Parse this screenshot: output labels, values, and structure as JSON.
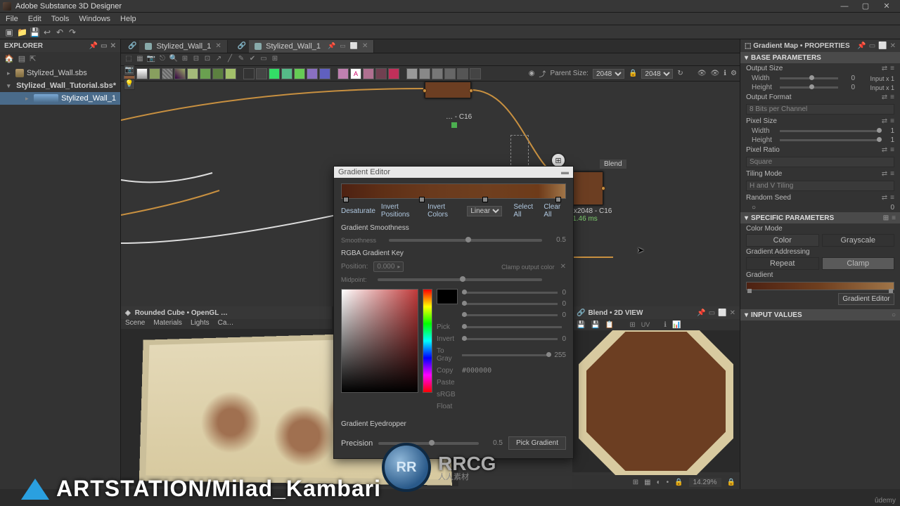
{
  "window": {
    "title": "Adobe Substance 3D Designer",
    "minimize": "—",
    "maximize": "▢",
    "close": "✕"
  },
  "menu": [
    "File",
    "Edit",
    "Tools",
    "Windows",
    "Help"
  ],
  "explorer": {
    "title": "EXPLORER",
    "items": [
      {
        "label": "Stylized_Wall.sbs",
        "icon": "pkg",
        "chev": "▸"
      },
      {
        "label": "Stylized_Wall_Tutorial.sbs*",
        "icon": "pkg",
        "chev": "▾",
        "bold": true
      },
      {
        "label": "Stylized_Wall_1",
        "icon": "graph",
        "chev": "▸",
        "sel": true
      }
    ]
  },
  "tabs": [
    {
      "label": "Stylized_Wall_1",
      "dirty": false
    },
    {
      "label": "Stylized_Wall_1",
      "dirty": false,
      "active": true
    }
  ],
  "parent_size_label": "Parent Size:",
  "parent_size": "2048",
  "res": "2048",
  "top_node_info": "… - C16",
  "blend": {
    "title": "Blend",
    "size": "2048x2048 - C16",
    "time": "1.46 ms"
  },
  "gradient_editor": {
    "title": "Gradient Editor",
    "desaturate": "Desaturate",
    "invert_pos": "Invert Positions",
    "invert_col": "Invert Colors",
    "interp": "Linear",
    "select_all": "Select All",
    "clear_all": "Clear All",
    "smooth_lbl": "Gradient Smoothness",
    "smooth_val": "0.5",
    "key_lbl": "RGBA Gradient Key",
    "pos_lbl": "Position:",
    "pos_val": "0.000",
    "clamp_lbl": "Clamp output color",
    "midpoint_lbl": "Midpoint:",
    "pick_lbl": "Pick",
    "invert_lbl": "Invert",
    "togray_lbl": "To Gray",
    "togray_val": "255",
    "copy_lbl": "Copy",
    "paste_lbl": "Paste",
    "srgb_lbl": "sRGB",
    "float_lbl": "Float",
    "hex": "#000000",
    "rgba0": "0",
    "rgba1": "0",
    "rgba2": "0",
    "rgba3": "0",
    "rgba4": "0",
    "eyedrop": "Gradient Eyedropper",
    "precision_lbl": "Precision",
    "precision_val": "0.5",
    "pick_grad": "Pick Gradient"
  },
  "view3d": {
    "title": "Rounded Cube • OpenGL …",
    "tabs": [
      "Scene",
      "Materials",
      "Lights",
      "Ca…"
    ]
  },
  "view2d": {
    "title": "Blend • 2D VIEW",
    "zoom": "14.29%"
  },
  "properties": {
    "title": "Gradient Map • PROPERTIES",
    "base": "BASE PARAMETERS",
    "output_size": "Output Size",
    "width": "Width",
    "height": "Height",
    "w_val": "0",
    "h_val": "0",
    "w_txt": "Input x 1",
    "h_txt": "Input x 1",
    "output_format": "Output Format",
    "of_val": "8 Bits per Channel",
    "pixel_size": "Pixel Size",
    "ps_w": "1",
    "ps_h": "1",
    "pixel_ratio": "Pixel Ratio",
    "pr_val": "Square",
    "tiling": "Tiling Mode",
    "tiling_val": "H and V Tiling",
    "seed": "Random Seed",
    "seed_val": "0",
    "specific": "SPECIFIC PARAMETERS",
    "color_mode": "Color Mode",
    "color": "Color",
    "grayscale": "Grayscale",
    "grad_addr": "Gradient Addressing",
    "repeat": "Repeat",
    "clamp": "Clamp",
    "gradient": "Gradient",
    "grad_btn": "Gradient Editor",
    "input_values": "INPUT VALUES"
  },
  "watermark": "ARTSTATION/Milad_Kambari",
  "rr": {
    "big": "RRCG",
    "sub": "人人素材"
  },
  "udemy": "ûdemy"
}
